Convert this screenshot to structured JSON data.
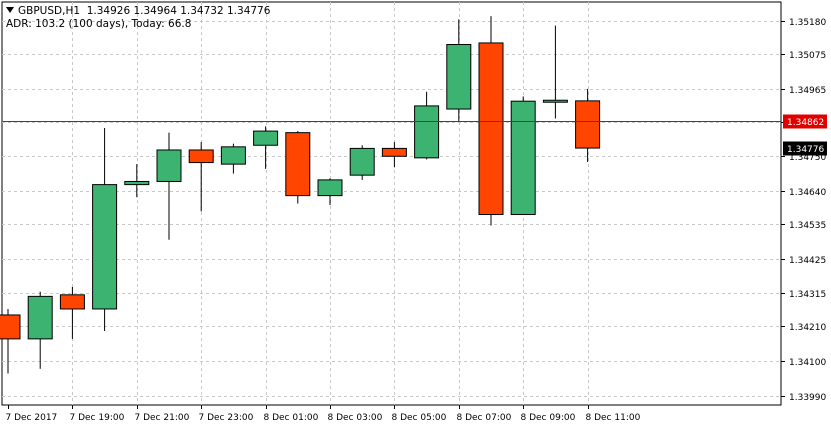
{
  "header": {
    "symbol": "GBPUSD,H1",
    "ohlc": "1.34926 1.34964 1.34732 1.34776",
    "adr": "ADR: 103.2 (100 days), Today: 66.8"
  },
  "colors": {
    "bull": "#3cb371",
    "bear": "#ff4500",
    "wick": "#000000",
    "grid": "#c8c8c8",
    "price_line": "#e00000",
    "price_tag": "#e00000",
    "current_tag": "#000000"
  },
  "chart_data": {
    "type": "candlestick",
    "title": "",
    "xlabel": "",
    "ylabel": "",
    "ylim": [
      1.3396,
      1.3524
    ],
    "grid": true,
    "y_ticks": [
      "1.35180",
      "1.35075",
      "1.34965",
      "1.34860",
      "1.34750",
      "1.34640",
      "1.34535",
      "1.34425",
      "1.34315",
      "1.34210",
      "1.34100",
      "1.33990"
    ],
    "x_labels": [
      "7 Dec 2017",
      "7 Dec 19:00",
      "7 Dec 21:00",
      "7 Dec 23:00",
      "8 Dec 01:00",
      "8 Dec 03:00",
      "8 Dec 05:00",
      "8 Dec 07:00",
      "8 Dec 09:00",
      "8 Dec 11:00"
    ],
    "price_line": {
      "value": 1.34862,
      "label": "1.34862"
    },
    "current_price": {
      "value": 1.34776,
      "label": "1.34776"
    },
    "candles": [
      {
        "time": "7 Dec 17:00",
        "open": 1.34246,
        "high": 1.34265,
        "low": 1.3406,
        "close": 1.3417
      },
      {
        "time": "7 Dec 18:00",
        "open": 1.3417,
        "high": 1.3432,
        "low": 1.34075,
        "close": 1.34305
      },
      {
        "time": "7 Dec 19:00",
        "open": 1.3431,
        "high": 1.34335,
        "low": 1.3417,
        "close": 1.34265
      },
      {
        "time": "7 Dec 20:00",
        "open": 1.34265,
        "high": 1.3484,
        "low": 1.34195,
        "close": 1.3466
      },
      {
        "time": "7 Dec 21:00",
        "open": 1.3466,
        "high": 1.34725,
        "low": 1.3462,
        "close": 1.3467
      },
      {
        "time": "7 Dec 22:00",
        "open": 1.3467,
        "high": 1.34825,
        "low": 1.34485,
        "close": 1.3477
      },
      {
        "time": "7 Dec 23:00",
        "open": 1.3477,
        "high": 1.34795,
        "low": 1.34575,
        "close": 1.3473
      },
      {
        "time": "8 Dec 00:00",
        "open": 1.34725,
        "high": 1.3479,
        "low": 1.34695,
        "close": 1.3478
      },
      {
        "time": "8 Dec 01:00",
        "open": 1.34785,
        "high": 1.34845,
        "low": 1.3471,
        "close": 1.3483
      },
      {
        "time": "8 Dec 02:00",
        "open": 1.34825,
        "high": 1.3483,
        "low": 1.346,
        "close": 1.34625
      },
      {
        "time": "8 Dec 03:00",
        "open": 1.34625,
        "high": 1.3468,
        "low": 1.34595,
        "close": 1.34675
      },
      {
        "time": "8 Dec 04:00",
        "open": 1.3469,
        "high": 1.34785,
        "low": 1.34675,
        "close": 1.34775
      },
      {
        "time": "8 Dec 05:00",
        "open": 1.34775,
        "high": 1.34795,
        "low": 1.34715,
        "close": 1.3475
      },
      {
        "time": "8 Dec 06:00",
        "open": 1.34745,
        "high": 1.34955,
        "low": 1.3474,
        "close": 1.3491
      },
      {
        "time": "8 Dec 07:00",
        "open": 1.349,
        "high": 1.35185,
        "low": 1.3486,
        "close": 1.35105
      },
      {
        "time": "8 Dec 08:00",
        "open": 1.3511,
        "high": 1.35195,
        "low": 1.3453,
        "close": 1.34565
      },
      {
        "time": "8 Dec 09:00",
        "open": 1.34565,
        "high": 1.3494,
        "low": 1.34565,
        "close": 1.34925
      },
      {
        "time": "8 Dec 10:00",
        "open": 1.34925,
        "high": 1.35165,
        "low": 1.3487,
        "close": 1.34928
      },
      {
        "time": "8 Dec 11:00",
        "open": 1.34926,
        "high": 1.34964,
        "low": 1.34732,
        "close": 1.34776
      }
    ]
  }
}
